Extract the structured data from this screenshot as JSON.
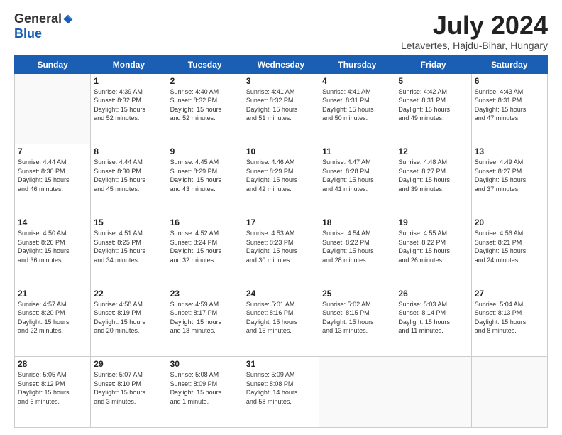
{
  "logo": {
    "general": "General",
    "blue": "Blue"
  },
  "title": "July 2024",
  "location": "Letavertes, Hajdu-Bihar, Hungary",
  "weekdays": [
    "Sunday",
    "Monday",
    "Tuesday",
    "Wednesday",
    "Thursday",
    "Friday",
    "Saturday"
  ],
  "weeks": [
    [
      {
        "day": "",
        "info": ""
      },
      {
        "day": "1",
        "info": "Sunrise: 4:39 AM\nSunset: 8:32 PM\nDaylight: 15 hours\nand 52 minutes."
      },
      {
        "day": "2",
        "info": "Sunrise: 4:40 AM\nSunset: 8:32 PM\nDaylight: 15 hours\nand 52 minutes."
      },
      {
        "day": "3",
        "info": "Sunrise: 4:41 AM\nSunset: 8:32 PM\nDaylight: 15 hours\nand 51 minutes."
      },
      {
        "day": "4",
        "info": "Sunrise: 4:41 AM\nSunset: 8:31 PM\nDaylight: 15 hours\nand 50 minutes."
      },
      {
        "day": "5",
        "info": "Sunrise: 4:42 AM\nSunset: 8:31 PM\nDaylight: 15 hours\nand 49 minutes."
      },
      {
        "day": "6",
        "info": "Sunrise: 4:43 AM\nSunset: 8:31 PM\nDaylight: 15 hours\nand 47 minutes."
      }
    ],
    [
      {
        "day": "7",
        "info": "Sunrise: 4:44 AM\nSunset: 8:30 PM\nDaylight: 15 hours\nand 46 minutes."
      },
      {
        "day": "8",
        "info": "Sunrise: 4:44 AM\nSunset: 8:30 PM\nDaylight: 15 hours\nand 45 minutes."
      },
      {
        "day": "9",
        "info": "Sunrise: 4:45 AM\nSunset: 8:29 PM\nDaylight: 15 hours\nand 43 minutes."
      },
      {
        "day": "10",
        "info": "Sunrise: 4:46 AM\nSunset: 8:29 PM\nDaylight: 15 hours\nand 42 minutes."
      },
      {
        "day": "11",
        "info": "Sunrise: 4:47 AM\nSunset: 8:28 PM\nDaylight: 15 hours\nand 41 minutes."
      },
      {
        "day": "12",
        "info": "Sunrise: 4:48 AM\nSunset: 8:27 PM\nDaylight: 15 hours\nand 39 minutes."
      },
      {
        "day": "13",
        "info": "Sunrise: 4:49 AM\nSunset: 8:27 PM\nDaylight: 15 hours\nand 37 minutes."
      }
    ],
    [
      {
        "day": "14",
        "info": "Sunrise: 4:50 AM\nSunset: 8:26 PM\nDaylight: 15 hours\nand 36 minutes."
      },
      {
        "day": "15",
        "info": "Sunrise: 4:51 AM\nSunset: 8:25 PM\nDaylight: 15 hours\nand 34 minutes."
      },
      {
        "day": "16",
        "info": "Sunrise: 4:52 AM\nSunset: 8:24 PM\nDaylight: 15 hours\nand 32 minutes."
      },
      {
        "day": "17",
        "info": "Sunrise: 4:53 AM\nSunset: 8:23 PM\nDaylight: 15 hours\nand 30 minutes."
      },
      {
        "day": "18",
        "info": "Sunrise: 4:54 AM\nSunset: 8:22 PM\nDaylight: 15 hours\nand 28 minutes."
      },
      {
        "day": "19",
        "info": "Sunrise: 4:55 AM\nSunset: 8:22 PM\nDaylight: 15 hours\nand 26 minutes."
      },
      {
        "day": "20",
        "info": "Sunrise: 4:56 AM\nSunset: 8:21 PM\nDaylight: 15 hours\nand 24 minutes."
      }
    ],
    [
      {
        "day": "21",
        "info": "Sunrise: 4:57 AM\nSunset: 8:20 PM\nDaylight: 15 hours\nand 22 minutes."
      },
      {
        "day": "22",
        "info": "Sunrise: 4:58 AM\nSunset: 8:19 PM\nDaylight: 15 hours\nand 20 minutes."
      },
      {
        "day": "23",
        "info": "Sunrise: 4:59 AM\nSunset: 8:17 PM\nDaylight: 15 hours\nand 18 minutes."
      },
      {
        "day": "24",
        "info": "Sunrise: 5:01 AM\nSunset: 8:16 PM\nDaylight: 15 hours\nand 15 minutes."
      },
      {
        "day": "25",
        "info": "Sunrise: 5:02 AM\nSunset: 8:15 PM\nDaylight: 15 hours\nand 13 minutes."
      },
      {
        "day": "26",
        "info": "Sunrise: 5:03 AM\nSunset: 8:14 PM\nDaylight: 15 hours\nand 11 minutes."
      },
      {
        "day": "27",
        "info": "Sunrise: 5:04 AM\nSunset: 8:13 PM\nDaylight: 15 hours\nand 8 minutes."
      }
    ],
    [
      {
        "day": "28",
        "info": "Sunrise: 5:05 AM\nSunset: 8:12 PM\nDaylight: 15 hours\nand 6 minutes."
      },
      {
        "day": "29",
        "info": "Sunrise: 5:07 AM\nSunset: 8:10 PM\nDaylight: 15 hours\nand 3 minutes."
      },
      {
        "day": "30",
        "info": "Sunrise: 5:08 AM\nSunset: 8:09 PM\nDaylight: 15 hours\nand 1 minute."
      },
      {
        "day": "31",
        "info": "Sunrise: 5:09 AM\nSunset: 8:08 PM\nDaylight: 14 hours\nand 58 minutes."
      },
      {
        "day": "",
        "info": ""
      },
      {
        "day": "",
        "info": ""
      },
      {
        "day": "",
        "info": ""
      }
    ]
  ]
}
